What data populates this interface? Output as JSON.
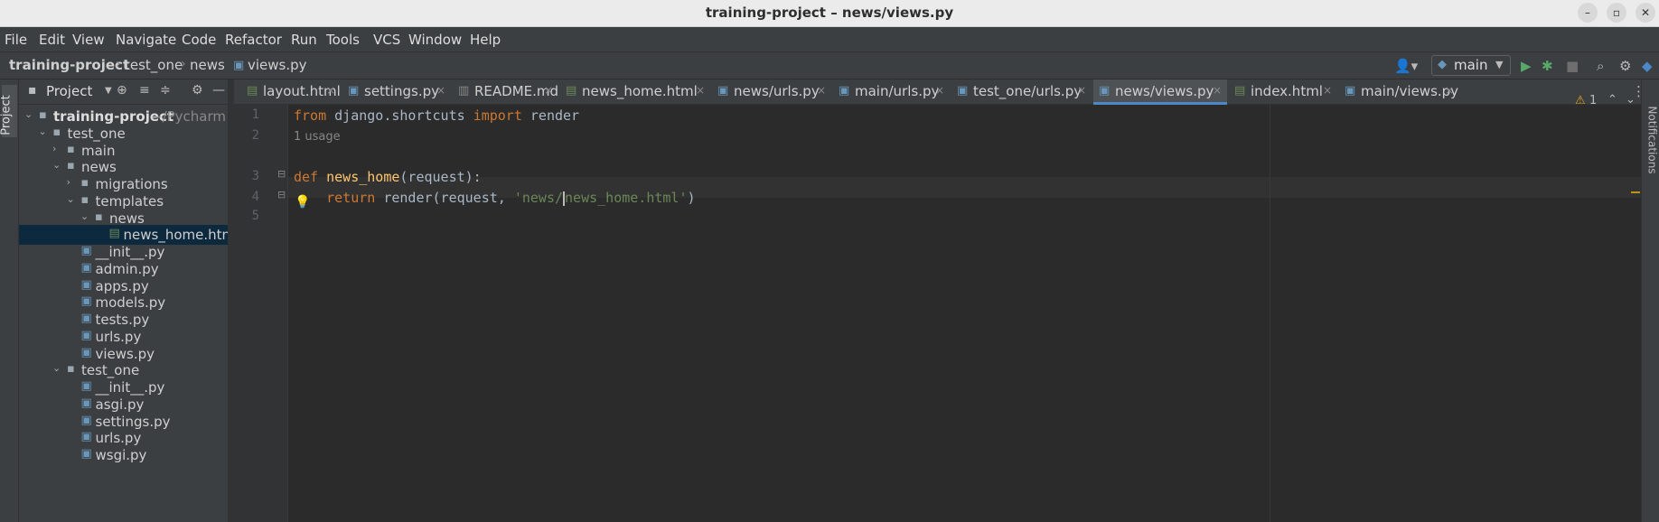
{
  "window": {
    "title": "training-project – news/views.py",
    "controls": [
      "minimize",
      "maximize",
      "close"
    ]
  },
  "menu": [
    "File",
    "Edit",
    "View",
    "Navigate",
    "Code",
    "Refactor",
    "Run",
    "Tools",
    "VCS",
    "Window",
    "Help"
  ],
  "breadcrumb": {
    "project": "training-project",
    "items": [
      "test_one",
      "news",
      "views.py"
    ]
  },
  "toolbar": {
    "run_config": "main"
  },
  "stripe": {
    "project_label": "Project"
  },
  "project_panel": {
    "title": "Project",
    "tree": [
      {
        "label": "training-project",
        "suffix": "~/Pycharm",
        "type": "folder",
        "depth": 0,
        "expanded": true,
        "bold": true
      },
      {
        "label": "test_one",
        "type": "folder",
        "depth": 1,
        "expanded": true
      },
      {
        "label": "main",
        "type": "folder",
        "depth": 2,
        "expanded": false
      },
      {
        "label": "news",
        "type": "folder",
        "depth": 2,
        "expanded": true
      },
      {
        "label": "migrations",
        "type": "folder",
        "depth": 3,
        "expanded": false
      },
      {
        "label": "templates",
        "type": "folder",
        "depth": 3,
        "expanded": true
      },
      {
        "label": "news",
        "type": "folder",
        "depth": 4,
        "expanded": true
      },
      {
        "label": "news_home.htm",
        "type": "html",
        "depth": 5,
        "selected": true
      },
      {
        "label": "__init__.py",
        "type": "py",
        "depth": 3
      },
      {
        "label": "admin.py",
        "type": "py",
        "depth": 3
      },
      {
        "label": "apps.py",
        "type": "py",
        "depth": 3
      },
      {
        "label": "models.py",
        "type": "py",
        "depth": 3
      },
      {
        "label": "tests.py",
        "type": "py",
        "depth": 3
      },
      {
        "label": "urls.py",
        "type": "py",
        "depth": 3
      },
      {
        "label": "views.py",
        "type": "py",
        "depth": 3
      },
      {
        "label": "test_one",
        "type": "folder",
        "depth": 2,
        "expanded": true
      },
      {
        "label": "__init__.py",
        "type": "py",
        "depth": 3
      },
      {
        "label": "asgi.py",
        "type": "py",
        "depth": 3
      },
      {
        "label": "settings.py",
        "type": "py",
        "depth": 3
      },
      {
        "label": "urls.py",
        "type": "py",
        "depth": 3
      },
      {
        "label": "wsgi.py",
        "type": "py",
        "depth": 3
      }
    ]
  },
  "tabs": [
    {
      "label": "layout.html",
      "type": "html",
      "active": false
    },
    {
      "label": "settings.py",
      "type": "py",
      "active": false
    },
    {
      "label": "README.md",
      "type": "md",
      "active": false
    },
    {
      "label": "news_home.html",
      "type": "html",
      "active": false
    },
    {
      "label": "news/urls.py",
      "type": "py",
      "active": false
    },
    {
      "label": "main/urls.py",
      "type": "py",
      "active": false
    },
    {
      "label": "test_one/urls.py",
      "type": "py",
      "active": false
    },
    {
      "label": "news/views.py",
      "type": "py",
      "active": true
    },
    {
      "label": "index.html",
      "type": "html",
      "active": false
    },
    {
      "label": "main/views.py",
      "type": "py",
      "active": false
    }
  ],
  "editor": {
    "inspections": "1",
    "usage_hint": "1 usage",
    "lines": [
      {
        "num": "1",
        "tokens": [
          [
            "kw",
            "from"
          ],
          [
            "",
            " django.shortcuts "
          ],
          [
            "kw",
            "import"
          ],
          [
            "",
            " render"
          ]
        ]
      },
      {
        "num": "2",
        "tokens": []
      },
      {
        "num": "3",
        "tokens": [
          [
            "kw",
            "def"
          ],
          [
            "",
            " "
          ],
          [
            "fn",
            "news_home"
          ],
          [
            "",
            "(request):"
          ]
        ]
      },
      {
        "num": "4",
        "tokens": [
          [
            "",
            "    "
          ],
          [
            "kw",
            "return"
          ],
          [
            "",
            " render(request, "
          ],
          [
            "str",
            "'news/"
          ],
          [
            "caret",
            ""
          ],
          [
            "str",
            "news_home.html'"
          ],
          [
            "",
            ")"
          ]
        ]
      },
      {
        "num": "5",
        "tokens": []
      }
    ]
  },
  "right_stripe": {
    "label": "Notifications"
  },
  "colors": {
    "accent": "#4a88c7",
    "selection": "#0d293e",
    "keyword": "#cc7832",
    "function": "#ffc66d",
    "string": "#6a8759"
  }
}
